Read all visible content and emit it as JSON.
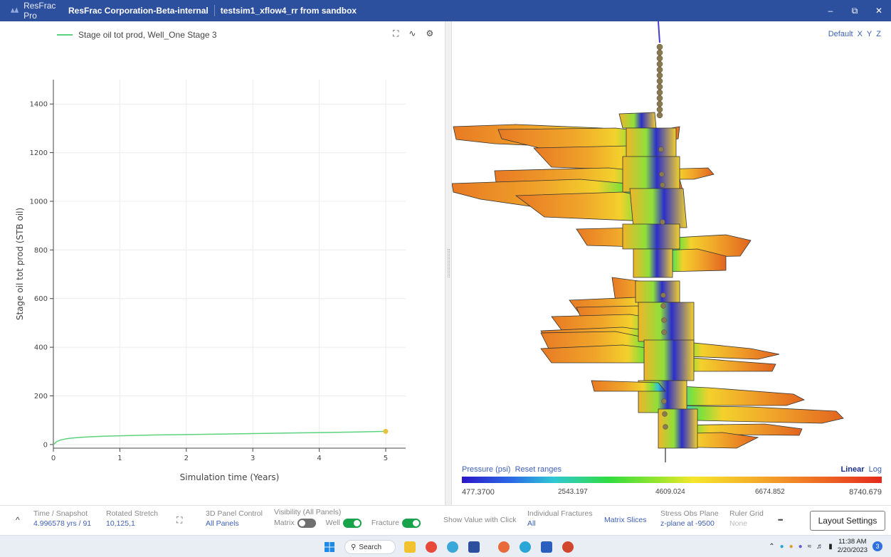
{
  "titlebar": {
    "app_name": "ResFrac Pro",
    "org": "ResFrac Corporation-Beta-internal",
    "project": "testsim1_xflow4_rr from sandbox",
    "minimize": "–",
    "maximize": "⧉",
    "close": "✕"
  },
  "left_panel": {
    "legend_label": "Stage oil tot prod, Well_One Stage 3",
    "tools": {
      "expand": "⛶",
      "trend": "∿",
      "settings": "⚙"
    }
  },
  "chart_data": {
    "type": "line",
    "title": "",
    "xlabel": "Simulation time (Years)",
    "ylabel": "Stage oil tot prod (STB oil)",
    "xlim": [
      0,
      5.3
    ],
    "ylim": [
      -15,
      1500
    ],
    "xticks": [
      0,
      1,
      2,
      3,
      4,
      5
    ],
    "yticks": [
      0,
      200,
      400,
      600,
      800,
      1000,
      1200,
      1400
    ],
    "grid": true,
    "series": [
      {
        "name": "Stage oil tot prod, Well_One Stage 3",
        "color": "#5bd37e",
        "x": [
          0,
          0.05,
          0.1,
          0.2,
          0.3,
          0.5,
          0.75,
          1,
          1.5,
          2,
          2.5,
          3,
          3.5,
          4,
          4.5,
          5
        ],
        "y": [
          0,
          12,
          18,
          24,
          27,
          31,
          34,
          36,
          39,
          41,
          43,
          45,
          47,
          49,
          51,
          54
        ]
      }
    ],
    "marker": {
      "x": 5,
      "y": 54,
      "color": "#e8c23a"
    }
  },
  "right_panel": {
    "view_axis": [
      "Default",
      "X",
      "Y",
      "Z"
    ],
    "colorbar": {
      "title": "Pressure (psi)",
      "reset": "Reset ranges",
      "scale_linear": "Linear",
      "scale_log": "Log",
      "ticks": [
        "477.3700",
        "2543.197",
        "4609.024",
        "6674.852",
        "8740.679"
      ]
    }
  },
  "bottombar": {
    "collapse": "^",
    "time_label": "Time / Snapshot",
    "time_value": "4.996578 yrs / 91",
    "stretch_label": "Rotated Stretch",
    "stretch_value": "10,125,1",
    "fit_icon": "⛶",
    "panel3d_label": "3D Panel Control",
    "panel3d_value": "All Panels",
    "visibility_label": "Visibility (All Panels)",
    "vis_matrix": "Matrix",
    "vis_well": "Well",
    "vis_fracture": "Fracture",
    "show_value": "Show Value with Click",
    "fractures_label": "Individual Fractures",
    "fractures_value": "All",
    "matrix_slices": "Matrix Slices",
    "stress_label": "Stress Obs Plane",
    "stress_value": "z-plane at -9500",
    "ruler_label": "Ruler Grid",
    "ruler_value": "None",
    "more": "•••",
    "layout_settings": "Layout Settings"
  },
  "taskbar": {
    "search": "Search",
    "time": "11:38 AM",
    "date": "2/20/2023",
    "notifications": "3"
  }
}
